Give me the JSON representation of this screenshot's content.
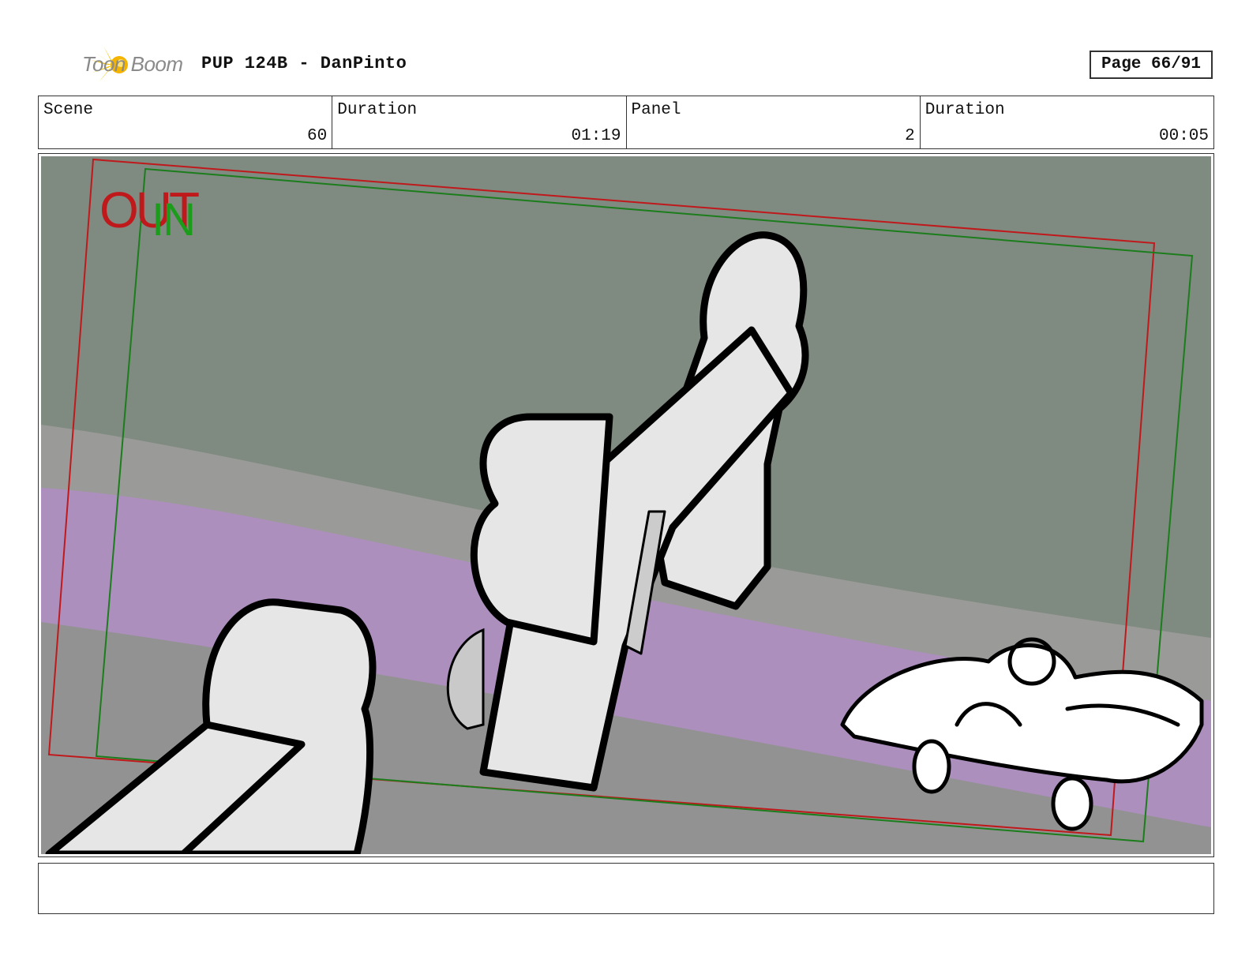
{
  "header": {
    "brand": "Toon Boom",
    "title": "PUP 124B - DanPinto",
    "page": "Page 66/91"
  },
  "info": {
    "scene_label": "Scene",
    "scene_value": "60",
    "scene_duration_label": "Duration",
    "scene_duration_value": "01:19",
    "panel_label": "Panel",
    "panel_value": "2",
    "panel_duration_label": "Duration",
    "panel_duration_value": "00:05"
  },
  "frame_labels": {
    "out": "OUT",
    "in": "IN"
  },
  "colors": {
    "wall": "#7f8a80",
    "road": "#9a9a98",
    "stripe": "#ad8fbe",
    "out_frame": "#c0191c",
    "in_frame": "#1b7d1b",
    "prop": "#e6e6e6"
  },
  "notes": {
    "text": ""
  }
}
